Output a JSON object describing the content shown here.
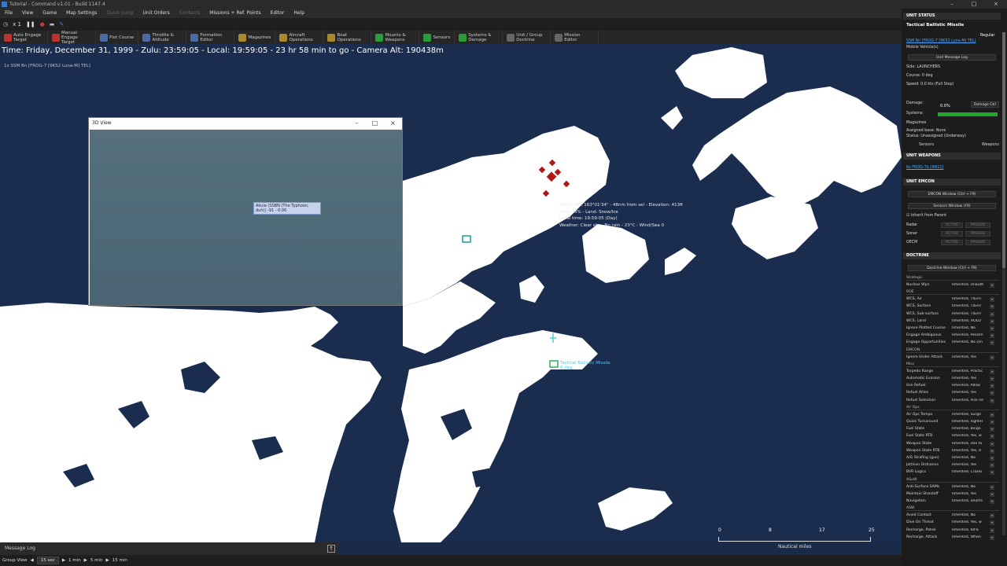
{
  "window": {
    "title": "Tutorial - Command v1.01 - Build 1147.4",
    "controls": [
      "–",
      "□",
      "×"
    ]
  },
  "menu": {
    "items": [
      "File",
      "View",
      "Game",
      "Map Settings",
      "Quick Jump",
      "Unit Orders",
      "Contacts",
      "Missions + Ref. Points",
      "Editor",
      "Help"
    ]
  },
  "toolbar1": {
    "speed": "x 1"
  },
  "toolbar2": {
    "items": [
      {
        "label": "Auto Engage Target",
        "color": "red"
      },
      {
        "label": "Manual Engage Target",
        "color": "red"
      },
      {
        "label": "Plot Course",
        "color": "blue"
      },
      {
        "label": "Throttle & Altitude",
        "color": "blue"
      },
      {
        "label": "Formation Editor",
        "color": "blue"
      },
      {
        "label": "Magazines",
        "color": "gold"
      },
      {
        "label": "Aircraft Operations",
        "color": "gold"
      },
      {
        "label": "Boat Operations",
        "color": "gold"
      },
      {
        "label": "Mounts & Weapons",
        "color": "green"
      },
      {
        "label": "Sensors",
        "color": "green"
      },
      {
        "label": "Systems & Damage",
        "color": "green"
      },
      {
        "label": "Unit / Group Doctrine",
        "color": "gray"
      },
      {
        "label": "Mission Editor",
        "color": "gray"
      }
    ]
  },
  "status": {
    "time": "Time: Friday, December 31, 1999 - Zulu: 23:59:05 - Local: 19:59:05 - 23 hr 58 min to go -  Camera Alt: 190438m",
    "unit_line": "1x SSM Bn [FROG-7 [9K52 Luna-M] TEL]"
  },
  "view3d": {
    "title": "3D View",
    "tag": "Akula (SSBN (The Typhoon, duh))  -91 - 0.00"
  },
  "tooltip": {
    "line1": "68°33'09\", 163°01'34\" - 48nm from sel - Elevation: 413ft",
    "line2": "Slope: 3% - Land: Snow/Ice",
    "line3": "Local time: 19:59:05 (Day)",
    "line4": "Weather: Clear sky - No rain - 23°C - Wind/Sea 0"
  },
  "map_unit": {
    "label1": "Tactical Ballistic Missile",
    "label2": "0 deg"
  },
  "scale": {
    "ticks": [
      "0",
      "8",
      "17",
      "25"
    ],
    "caption": "Nautical miles"
  },
  "message_log": {
    "label": "Message Log",
    "expand": "↑"
  },
  "bottom": {
    "group_view": "Group View",
    "steps": [
      "15 sec",
      "1 min",
      "5 min",
      "15 min"
    ]
  },
  "panel": {
    "unit_status": {
      "header": "UNIT STATUS",
      "name": "Tactical Ballistic Missile",
      "proficiency": "Regular",
      "unit_link": "SSM Bn [FROG-7 [9K52 Luna-M] TEL]",
      "type": "Mobile Vehicle(s)",
      "message_log_btn": "Unit Message Log",
      "side": "Side: LAUNCHERS",
      "course": "Course: 0 deg",
      "speed": "Speed: 0.0 kts (Full Stop)",
      "damage_label": "Damage:",
      "damage_value": "0.0%",
      "damage_ctrl": "Damage Ctrl",
      "systems_label": "Systems:",
      "magazines_label": "Magazines",
      "assigned_base": "Assigned base: None",
      "status_line": "Status: Unassigned (Underway)",
      "sensors_btn": "Sensors",
      "weapons_btn": "Weapons"
    },
    "unit_weapons": {
      "header": "UNIT WEAPONS",
      "link": "6x FROG-7b [9M21]"
    },
    "unit_emcon": {
      "header": "UNIT EMCON",
      "emcon_btn": "EMCON Window (Ctrl + F9)",
      "sensors_btn": "Sensors Window (F9)",
      "inherit": "Inherit from Parent",
      "rows": [
        {
          "label": "Radar",
          "active": "ACTIVE",
          "passive": "PASSIVE"
        },
        {
          "label": "Sonar",
          "active": "ACTIVE",
          "passive": "PASSIVE"
        },
        {
          "label": "OECM",
          "active": "ACTIVE",
          "passive": "PASSIVE"
        }
      ]
    },
    "doctrine": {
      "header": "DOCTRINE",
      "window_btn": "Doctrine Window (Ctrl + F9)",
      "groups": [
        {
          "name": "Strategic",
          "rows": [
            [
              "Nuclear Wpn",
              "Inherited, Unauth"
            ]
          ]
        },
        {
          "name": "ROE",
          "rows": [
            [
              "WCS, Air",
              "Inherited, TIGHT"
            ],
            [
              "WCS, Surface",
              "Inherited, TIGHT"
            ],
            [
              "WCS, Sub-surface",
              "Inherited, TIGHT"
            ],
            [
              "WCS, Land",
              "Inherited, HOLD"
            ],
            [
              "Ignore Plotted Course",
              "Inherited, No"
            ],
            [
              "Engage Ambiguous",
              "Inherited, Pessim"
            ],
            [
              "Engage Opportunities",
              "Inherited, No (on"
            ]
          ]
        },
        {
          "name": "EMCON",
          "rows": [
            [
              "Ignore Under Attack",
              "Inherited, Yes"
            ]
          ]
        },
        {
          "name": "Misc",
          "rows": [
            [
              "Torpedo Range",
              "Inherited, Practic"
            ],
            [
              "Automatic Evasion",
              "Inherited, Yes"
            ],
            [
              "Use Refuel",
              "Inherited, Allow"
            ],
            [
              "Refuel Allies",
              "Inherited, Yes"
            ],
            [
              "Refuel Selection",
              "Inherited, Pick ne"
            ]
          ]
        },
        {
          "name": "Air Ops",
          "rows": [
            [
              "Air Ops Tempo",
              "Inherited, Surge"
            ],
            [
              "Quick Turnaround",
              "Inherited, Fighter"
            ],
            [
              "Fuel State",
              "Inherited, Bingo"
            ],
            [
              "Fuel State RTB",
              "Inherited, Yes, w"
            ],
            [
              "Weapon State",
              "Inherited, Use to"
            ],
            [
              "Weapon State RTB",
              "Inherited, Yes, R"
            ],
            [
              "A/G Strafing (gun)",
              "Inherited, No"
            ],
            [
              "Jettison Ordnance",
              "Inherited, Yes"
            ],
            [
              "BVR Logics",
              "Inherited, Cranki"
            ]
          ]
        },
        {
          "name": "ASuW",
          "rows": [
            [
              "Anti-Surface SAMs",
              "Inherited, No"
            ],
            [
              "Maintain Standoff",
              "Inherited, Yes"
            ],
            [
              "Navigation",
              "Inherited, Shorte"
            ]
          ]
        },
        {
          "name": "ASW",
          "rows": [
            [
              "Avoid Contact",
              "Inherited, No"
            ],
            [
              "Dive On Threat",
              "Inherited, Yes, w"
            ],
            [
              "Recharge, Patrol",
              "Inherited, 60%"
            ],
            [
              "Recharge, Attack",
              "Inherited, When"
            ]
          ]
        }
      ]
    }
  }
}
